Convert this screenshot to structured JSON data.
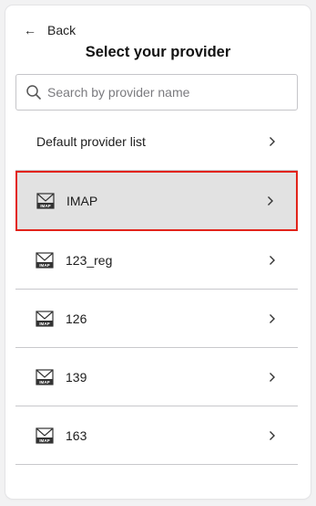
{
  "header": {
    "back_label": "Back",
    "title": "Select your provider"
  },
  "search": {
    "placeholder": "Search by provider name",
    "value": ""
  },
  "providers": [
    {
      "label": "Default provider list",
      "icon": "none",
      "selected": false
    },
    {
      "label": "IMAP",
      "icon": "imap-mail-icon",
      "selected": true
    },
    {
      "label": "123_reg",
      "icon": "imap-mail-icon",
      "selected": false
    },
    {
      "label": "126",
      "icon": "imap-mail-icon",
      "selected": false
    },
    {
      "label": "139",
      "icon": "imap-mail-icon",
      "selected": false
    },
    {
      "label": "163",
      "icon": "imap-mail-icon",
      "selected": false
    }
  ],
  "icon_badge_text": "IMAP",
  "colors": {
    "selected_bg": "#e2e2e2",
    "selected_border": "#e2231a",
    "divider": "#c8c8cc"
  }
}
